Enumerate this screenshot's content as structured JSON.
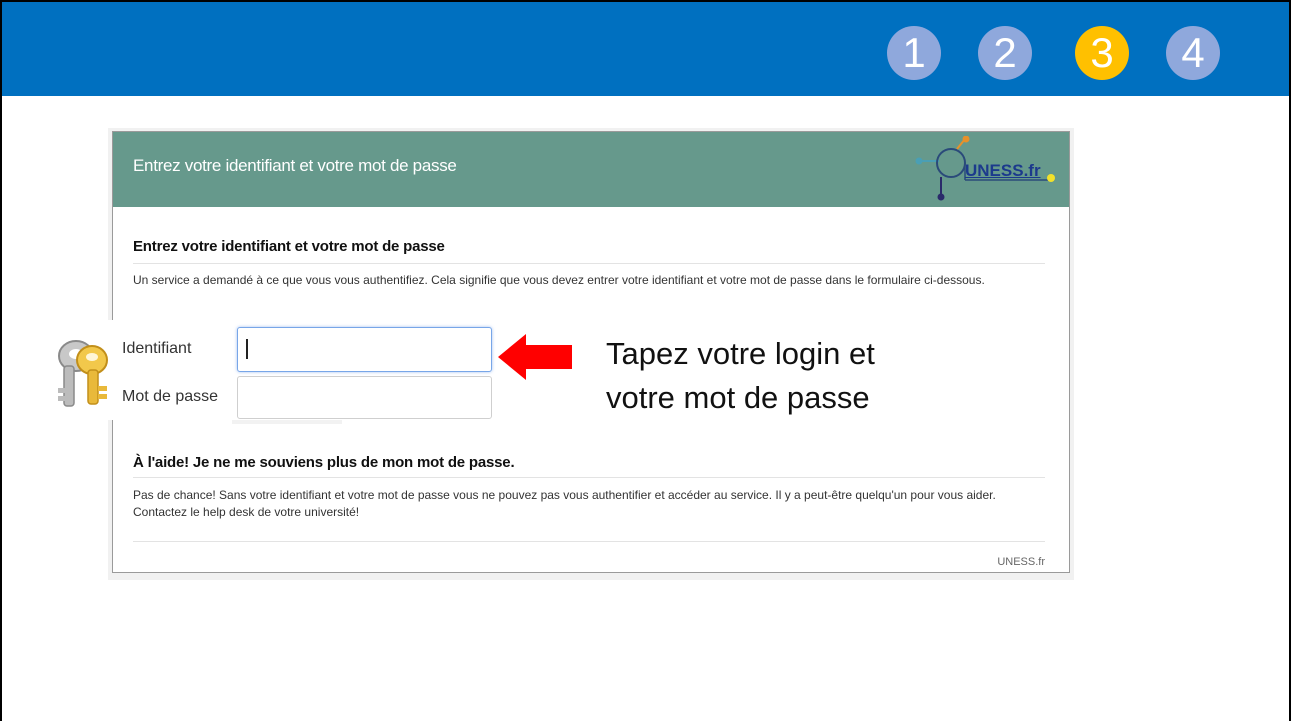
{
  "steps": [
    {
      "label": "1",
      "active": false
    },
    {
      "label": "2",
      "active": false
    },
    {
      "label": "3",
      "active": true
    },
    {
      "label": "4",
      "active": false
    }
  ],
  "colors": {
    "banner": "#0070c0",
    "step_inactive": "#8fa8dc",
    "step_active": "#ffc000",
    "header": "#66998c",
    "arrow": "#ff0000"
  },
  "login_page": {
    "header_title": "Entrez votre identifiant et votre mot de passe",
    "logo_text": "UNESS.fr",
    "section1_title": "Entrez votre identifiant et votre mot de passe",
    "section1_text": "Un service a demandé à ce que vous vous authentifiez. Cela signifie que vous devez entrer votre identifiant et votre mot de passe dans le formulaire ci-dessous.",
    "username_label": "Identifiant",
    "username_value": "",
    "password_label": "Mot de passe",
    "password_value": "",
    "section2_title": "À l'aide! Je ne me souviens plus de mon mot de passe.",
    "section2_text": "Pas de chance! Sans votre identifiant et votre mot de passe vous ne pouvez pas vous authentifier et accéder au service. Il y a peut-être quelqu'un pour vous aider. Contactez le help desk de votre université!",
    "footer": "UNESS.fr"
  },
  "callout": {
    "line1": "Tapez votre login et",
    "line2": "votre mot de passe"
  },
  "icons": {
    "keys": "keys-icon",
    "arrow": "left-arrow-icon"
  }
}
